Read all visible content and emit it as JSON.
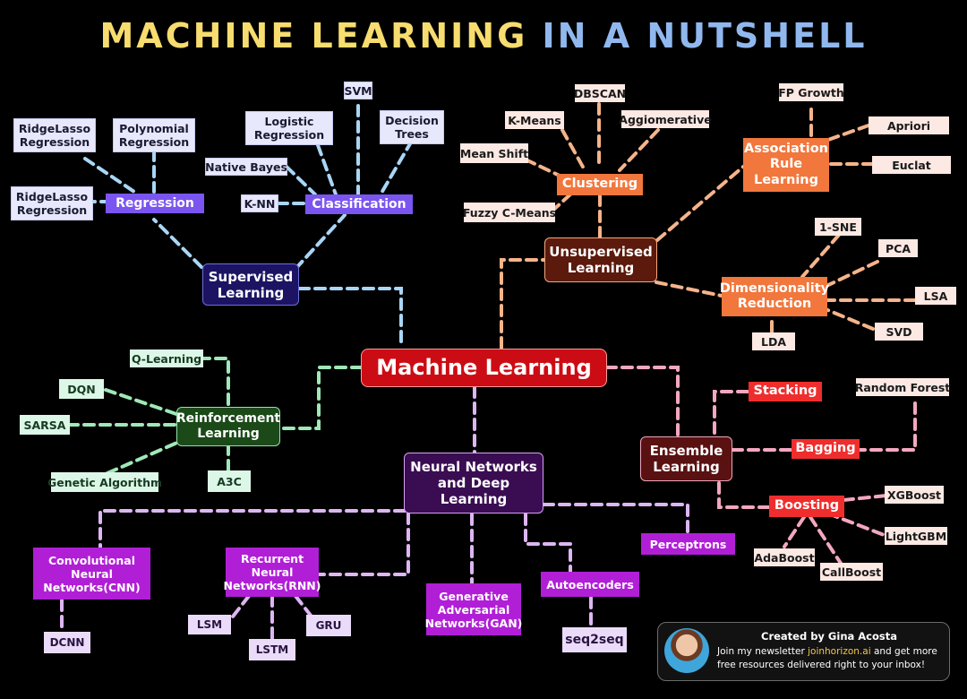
{
  "title": {
    "part1": "MACHINE LEARNING",
    "part2": "IN A NUTSHELL"
  },
  "center": "Machine Learning",
  "supervised": {
    "hub": "Supervised Learning",
    "regression": "Regression",
    "regression_leaves": [
      "RidgeLasso Regression",
      "Polynomial Regression",
      "RidgeLasso Regression"
    ],
    "classification": "Classification",
    "classification_leaves": [
      "Logistic Regression",
      "SVM",
      "Decision Trees",
      "Native Bayes",
      "K-NN"
    ]
  },
  "unsupervised": {
    "hub": "Unsupervised Learning",
    "clustering": "Clustering",
    "clustering_leaves": [
      "DBSCAN",
      "K-Means",
      "Aggiomerative",
      "Mean Shift",
      "Fuzzy C-Means"
    ],
    "association": "Association Rule Learning",
    "association_leaves": [
      "FP Growth",
      "Apriori",
      "Euclat"
    ],
    "dimensionality": "Dimensionality Reduction",
    "dimensionality_leaves": [
      "1-SNE",
      "PCA",
      "LSA",
      "SVD",
      "LDA"
    ]
  },
  "reinforcement": {
    "hub": "Reinforcement Learning",
    "leaves": [
      "Q-Learning",
      "DQN",
      "SARSA",
      "Genetic Algorithm",
      "A3C"
    ]
  },
  "ensemble": {
    "hub": "Ensemble Learning",
    "stacking": "Stacking",
    "bagging": "Bagging",
    "bagging_leaves": [
      "Random Forest"
    ],
    "boosting": "Boosting",
    "boosting_leaves": [
      "XGBoost",
      "LightGBM",
      "CallBoost",
      "AdaBoost"
    ]
  },
  "neural": {
    "hub": "Neural Networks and Deep Learning",
    "cnn": "Convolutional Neural Networks(CNN)",
    "cnn_leaves": [
      "DCNN"
    ],
    "rnn": "Recurrent Neural Networks(RNN)",
    "rnn_leaves": [
      "LSM",
      "LSTM",
      "GRU"
    ],
    "gan": "Generative Adversarial Networks(GAN)",
    "autoencoders": "Autoencoders",
    "autoencoders_leaves": [
      "seq2seq"
    ],
    "perceptrons": "Perceptrons"
  },
  "credit": {
    "title": "Created by Gina Acosta",
    "line1_pre": "Join my newsletter ",
    "line1_link": "joinhorizon.ai",
    "line1_post": " and get more",
    "line2": "free resources delivered right to your inbox!"
  },
  "colors": {
    "supervised_line": "#a9d6f5",
    "unsupervised_line": "#f5b48a",
    "reinforcement_line": "#9fe8b8",
    "ensemble_line": "#f4a7bf",
    "neural_line": "#ddb6f2",
    "center": "#cc0c14"
  }
}
